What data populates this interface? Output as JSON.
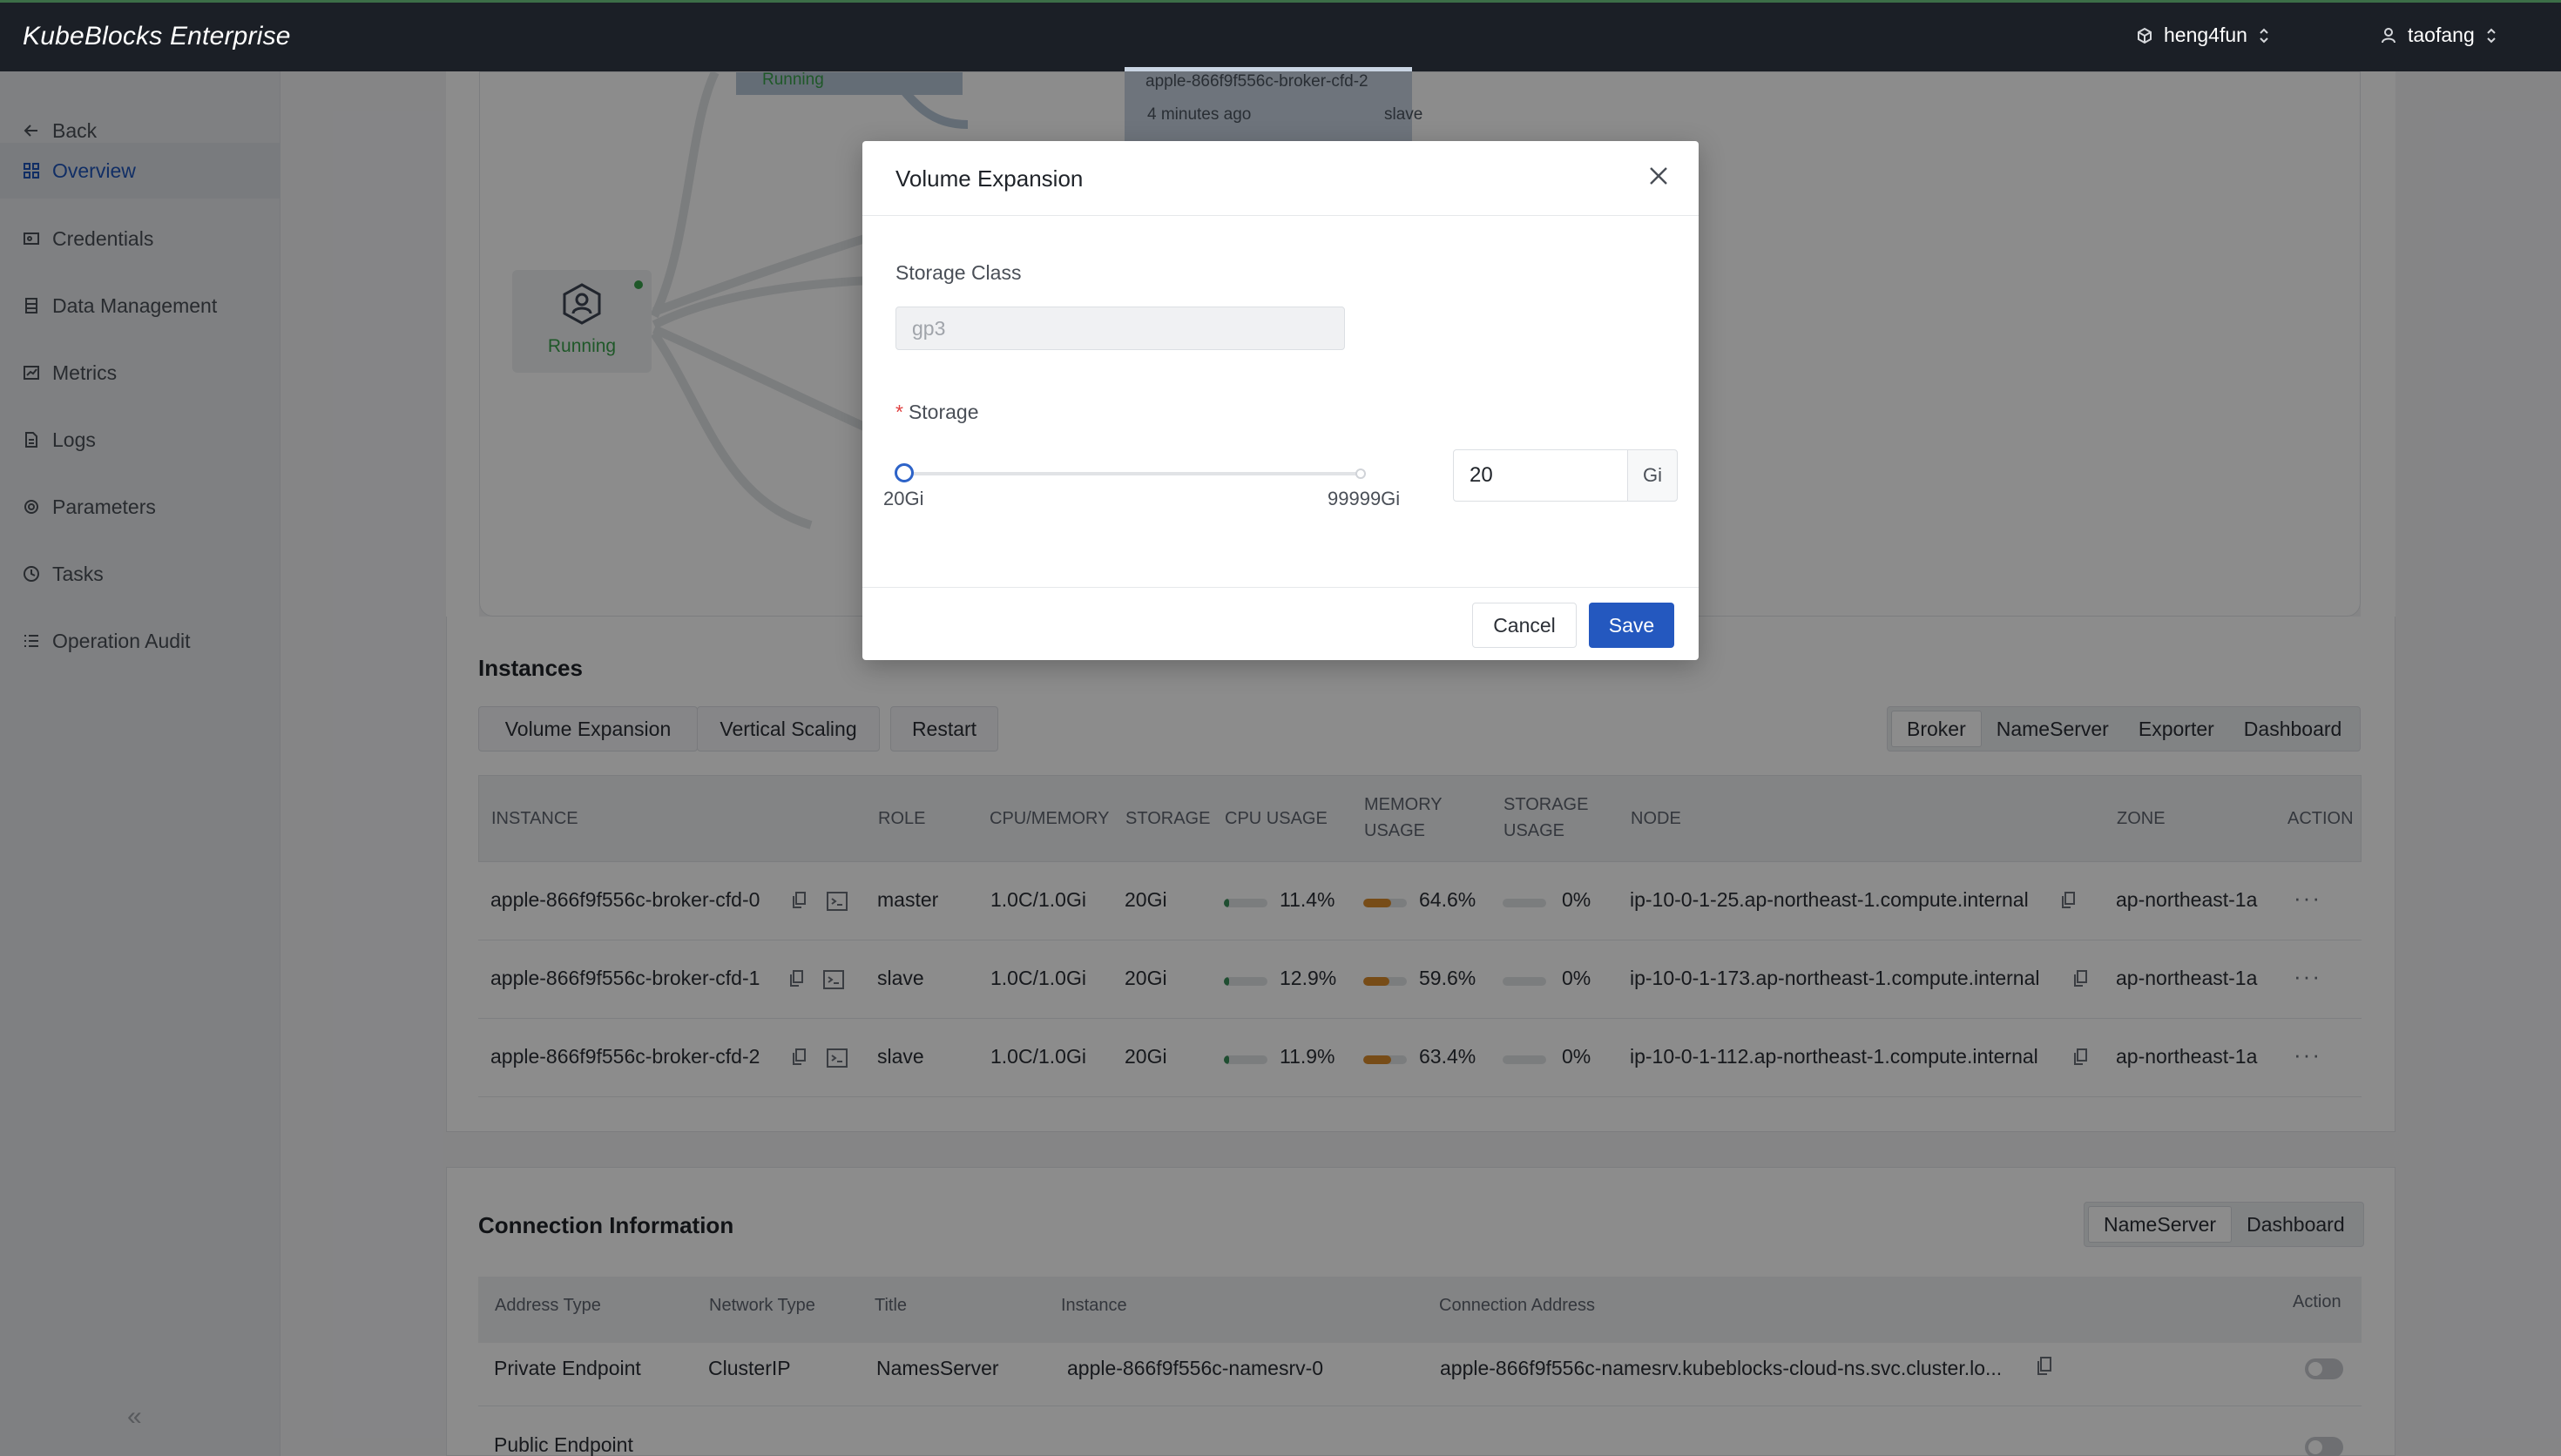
{
  "app": {
    "brand": "KubeBlocks Enterprise"
  },
  "topbar": {
    "org": "heng4fun",
    "user": "taofang"
  },
  "sidebar": {
    "back": "Back",
    "items": [
      {
        "label": "Overview",
        "icon": "grid-icon",
        "active": true
      },
      {
        "label": "Credentials",
        "icon": "key-card-icon"
      },
      {
        "label": "Data Management",
        "icon": "database-icon"
      },
      {
        "label": "Metrics",
        "icon": "chart-icon"
      },
      {
        "label": "Logs",
        "icon": "document-icon"
      },
      {
        "label": "Parameters",
        "icon": "gear-icon"
      },
      {
        "label": "Tasks",
        "icon": "clock-icon"
      },
      {
        "label": "Operation Audit",
        "icon": "list-icon"
      }
    ],
    "collapse": "«"
  },
  "topology": {
    "node_status": "Running",
    "top_card_status": "Running",
    "card_name": "apple-866f9f556c-broker-cfd-2",
    "card_time": "4 minutes ago",
    "card_role": "slave"
  },
  "instances": {
    "title": "Instances",
    "actions": [
      "Volume Expansion",
      "Vertical Scaling",
      "Restart"
    ],
    "tabs": [
      "Broker",
      "NameServer",
      "Exporter",
      "Dashboard"
    ],
    "columns": {
      "instance": "INSTANCE",
      "role": "ROLE",
      "cpu_memory": "CPU/MEMORY",
      "storage": "STORAGE",
      "cpu_usage": "CPU USAGE",
      "memory_usage_1": "MEMORY",
      "memory_usage_2": "USAGE",
      "storage_usage_1": "STORAGE",
      "storage_usage_2": "USAGE",
      "node": "NODE",
      "zone": "ZONE",
      "action": "ACTION"
    },
    "rows": [
      {
        "instance": "apple-866f9f556c-broker-cfd-0",
        "role": "master",
        "cpu_memory": "1.0C/1.0Gi",
        "storage": "20Gi",
        "cpu_usage": "11.4%",
        "cpu_frac": 0.114,
        "memory_usage": "64.6%",
        "mem_frac": 0.646,
        "storage_usage": "0%",
        "stor_frac": 0,
        "node": "ip-10-0-1-25.ap-northeast-1.compute.internal",
        "zone": "ap-northeast-1a",
        "action": "···"
      },
      {
        "instance": "apple-866f9f556c-broker-cfd-1",
        "role": "slave",
        "cpu_memory": "1.0C/1.0Gi",
        "storage": "20Gi",
        "cpu_usage": "12.9%",
        "cpu_frac": 0.129,
        "memory_usage": "59.6%",
        "mem_frac": 0.596,
        "storage_usage": "0%",
        "stor_frac": 0,
        "node": "ip-10-0-1-173.ap-northeast-1.compute.internal",
        "zone": "ap-northeast-1a",
        "action": "···"
      },
      {
        "instance": "apple-866f9f556c-broker-cfd-2",
        "role": "slave",
        "cpu_memory": "1.0C/1.0Gi",
        "storage": "20Gi",
        "cpu_usage": "11.9%",
        "cpu_frac": 0.119,
        "memory_usage": "63.4%",
        "mem_frac": 0.634,
        "storage_usage": "0%",
        "stor_frac": 0,
        "node": "ip-10-0-1-112.ap-northeast-1.compute.internal",
        "zone": "ap-northeast-1a",
        "action": "···"
      }
    ]
  },
  "connection": {
    "title": "Connection Information",
    "tabs": [
      "NameServer",
      "Dashboard"
    ],
    "columns": {
      "address_type": "Address Type",
      "network_type": "Network Type",
      "title": "Title",
      "instance": "Instance",
      "address": "Connection Address",
      "action": "Action"
    },
    "rows": [
      {
        "address_type": "Private Endpoint",
        "network_type": "ClusterIP",
        "title": "NamesServer",
        "instance": "apple-866f9f556c-namesrv-0",
        "address": "apple-866f9f556c-namesrv.kubeblocks-cloud-ns.svc.cluster.lo..."
      },
      {
        "address_type": "Public Endpoint",
        "network_type": "",
        "title": "",
        "instance": "",
        "address": ""
      }
    ]
  },
  "modal": {
    "title": "Volume Expansion",
    "storage_class_label": "Storage Class",
    "storage_class_value": "gp3",
    "storage_label": "Storage",
    "required_mark": "*",
    "slider_min_label": "20Gi",
    "slider_max_label": "99999Gi",
    "slider_min": 20,
    "slider_max": 99999,
    "storage_value": "20",
    "unit": "Gi",
    "cancel": "Cancel",
    "save": "Save"
  },
  "colors": {
    "accent": "#2458bf",
    "cpu_bar": "#3a8f5a",
    "mem_bar": "#d98a2b",
    "running": "#3aa04b"
  }
}
